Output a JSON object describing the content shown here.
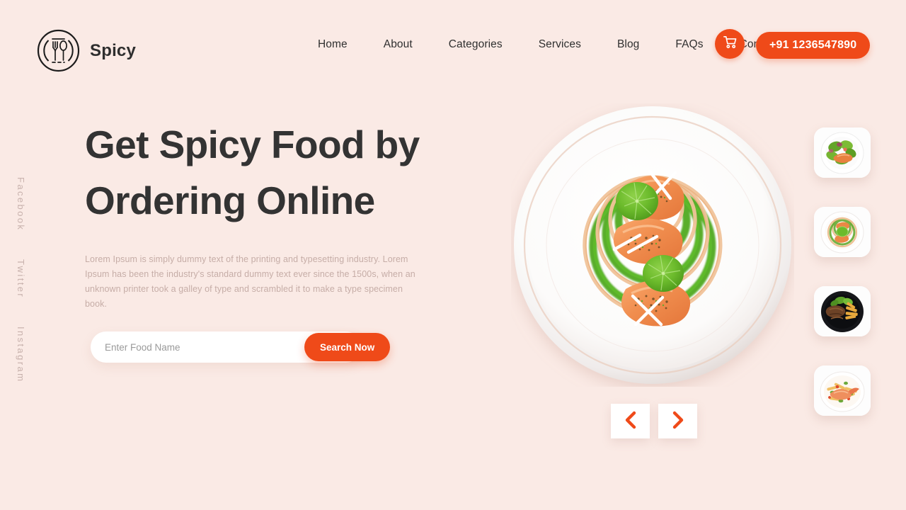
{
  "brand": {
    "name": "Spicy",
    "logo_icon": "fork-spoon-plate-icon"
  },
  "nav": {
    "items": [
      {
        "label": "Home"
      },
      {
        "label": "About"
      },
      {
        "label": "Categories"
      },
      {
        "label": "Services"
      },
      {
        "label": "Blog"
      },
      {
        "label": "FAQs"
      },
      {
        "label": "Contacts"
      }
    ],
    "cart_icon": "shopping-cart-icon",
    "phone_label": "+91 1236547890"
  },
  "social": {
    "items": [
      {
        "label": "Facebook"
      },
      {
        "label": "Twitter"
      },
      {
        "label": "Instagram"
      }
    ]
  },
  "hero": {
    "title": "Get Spicy Food by Ordering Online",
    "description": "Lorem Ipsum is simply dummy text of the printing and typesetting industry. Lorem Ipsum has been the industry's standard dummy text ever since the 1500s, when an unknown printer took a galley of type and scrambled it to make a type specimen book.",
    "search_placeholder": "Enter Food Name",
    "search_value": "",
    "search_button_label": "Search Now",
    "plate_image_alt": "salmon-with-sauce-spiral-plate"
  },
  "carousel": {
    "prev_icon": "chevron-left-icon",
    "next_icon": "chevron-right-icon"
  },
  "thumbnails": [
    {
      "alt": "salmon-salad-plate"
    },
    {
      "alt": "salmon-green-swirl-plate"
    },
    {
      "alt": "steak-and-fries-black-plate"
    },
    {
      "alt": "shrimp-pasta-plate"
    }
  ],
  "colors": {
    "background": "#faeae5",
    "accent": "#ef4a19",
    "heading": "#333333",
    "body_text": "#c6ada7",
    "nav_text": "#2f2f2f",
    "card": "#ffffff"
  }
}
